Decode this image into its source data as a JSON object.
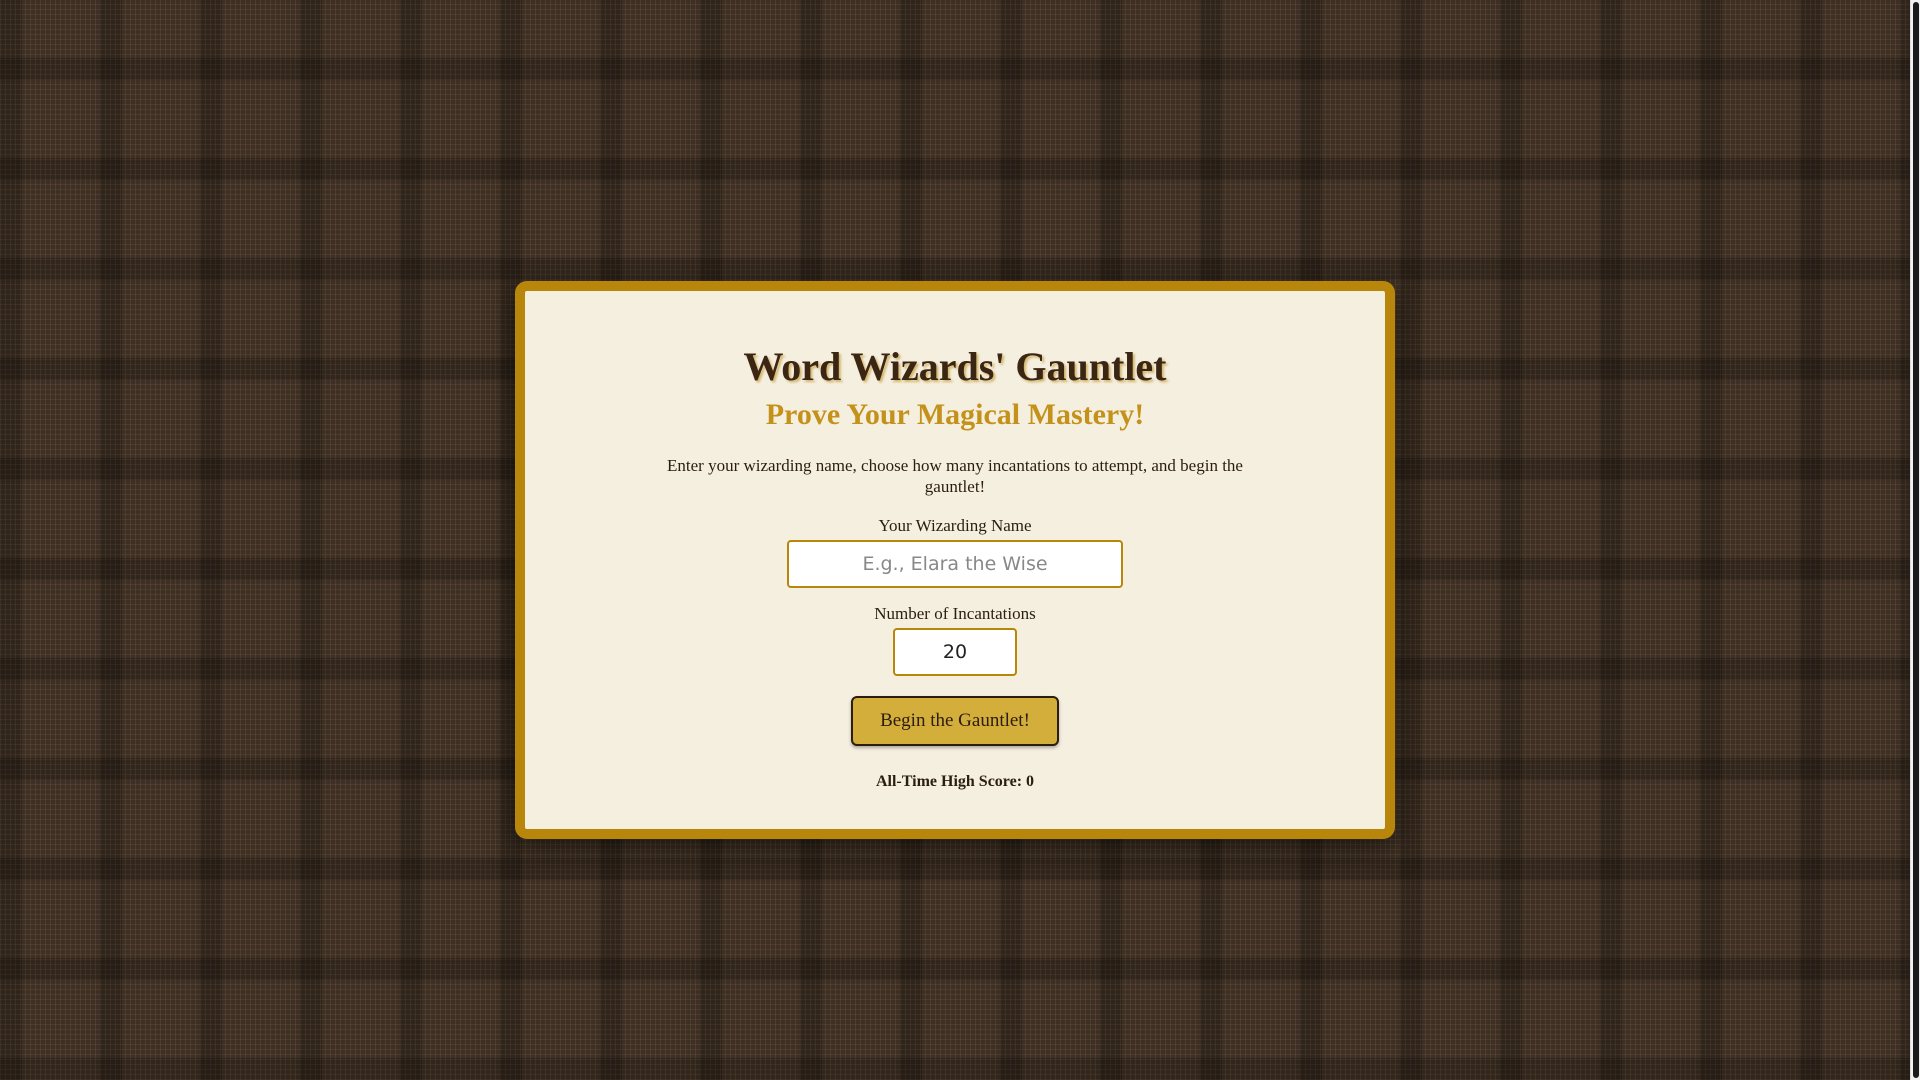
{
  "game": {
    "title": "Word Wizards' Gauntlet",
    "subtitle": "Prove Your Magical Mastery!",
    "instructions": "Enter your wizarding name, choose how many incantations to attempt, and begin the gauntlet!"
  },
  "form": {
    "name_label": "Your Wizarding Name",
    "name_placeholder": "E.g., Elara the Wise",
    "name_value": "",
    "count_label": "Number of Incantations",
    "count_value": "20",
    "begin_label": "Begin the Gauntlet!"
  },
  "high_score": {
    "label": "All-Time High Score:",
    "value": "0"
  },
  "colors": {
    "background": "#3d2f23",
    "panel": "#f5efe0",
    "border_gold": "#b8860b",
    "subtitle_gold": "#c4921a",
    "button_gold": "#d4ae3a",
    "text_dark": "#2b1d10"
  }
}
